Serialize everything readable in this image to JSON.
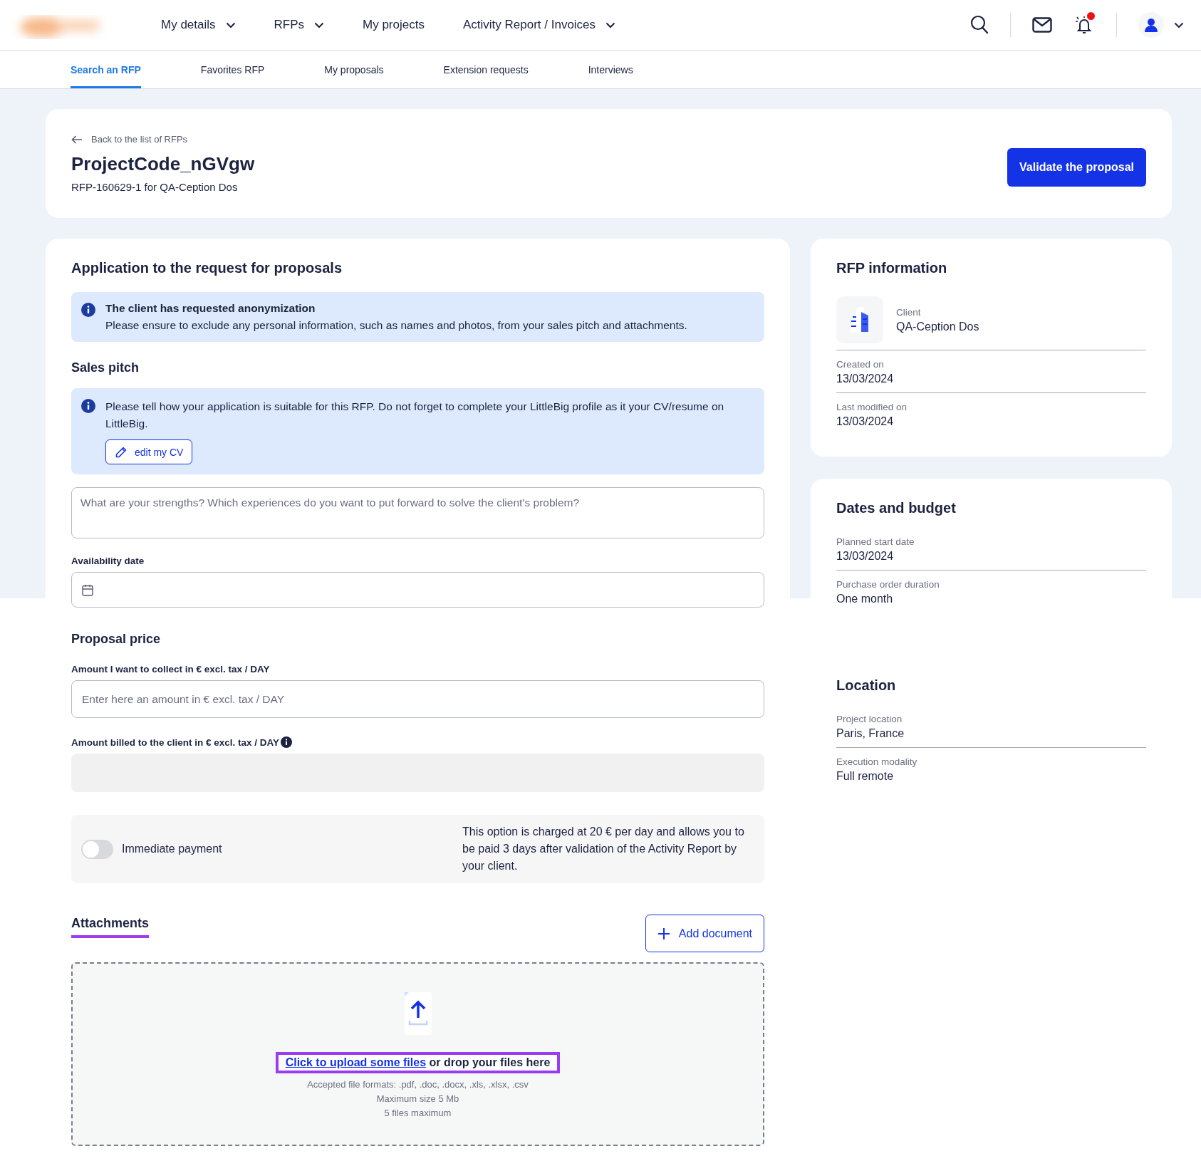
{
  "header": {
    "nav": [
      {
        "label": "My details",
        "dropdown": true
      },
      {
        "label": "RFPs",
        "dropdown": true
      },
      {
        "label": "My projects",
        "dropdown": false
      },
      {
        "label": "Activity Report / Invoices",
        "dropdown": true
      }
    ],
    "notifications": {
      "unread": true
    }
  },
  "tabs": [
    {
      "label": "Search an RFP",
      "selected": true
    },
    {
      "label": "Favorites RFP",
      "selected": false
    },
    {
      "label": "My proposals",
      "selected": false
    },
    {
      "label": "Extension requests",
      "selected": false
    },
    {
      "label": "Interviews",
      "selected": false
    }
  ],
  "project": {
    "back_link": "Back to the list of RFPs",
    "title": "ProjectCode_nGVgw",
    "subtitle": "RFP-160629-1 for QA-Ception Dos",
    "validate_button": "Validate the proposal"
  },
  "application": {
    "title": "Application to the request for proposals",
    "anonymization_notice": {
      "title": "The client has requested anonymization",
      "text": "Please ensure to exclude any personal information, such as names and photos, from your sales pitch and attachments."
    },
    "sales_pitch": {
      "title": "Sales pitch",
      "notice": "Please tell how your application is suitable for this RFP. Do not forget to complete your LittleBig profile as it your CV/resume on LittleBig.",
      "edit_cv_button": "edit my CV",
      "placeholder": "What are your strengths? Which experiences do you want to put forward to solve the client’s problem?"
    },
    "availability": {
      "label": "Availability date"
    },
    "proposal_price": {
      "title": "Proposal price",
      "amount_label": "Amount I want to collect in € excl. tax / DAY",
      "amount_placeholder": "Enter here an amount in € excl. tax / DAY",
      "billed_label": "Amount billed to the client in € excl. tax / DAY"
    },
    "immediate_payment": {
      "label": "Immediate payment",
      "on": false,
      "description": "This option is charged at 20 € per day and allows you to be paid 3 days after validation of the Activity Report by your client."
    },
    "attachments": {
      "title": "Attachments",
      "add_button": "Add document",
      "upload_link": "Click to upload some files",
      "upload_text": "or drop your files here",
      "formats": "Accepted file formats: .pdf, .doc, .docx, .xls, .xlsx, .csv",
      "max_size": "Maximum size 5 Mb",
      "max_files": "5 files maximum"
    }
  },
  "sidebar": [
    {
      "title": "RFP information",
      "client": {
        "label": "Client",
        "value": "QA-Ception Dos"
      },
      "fields": [
        {
          "label": "Created on",
          "value": "13/03/2024"
        },
        {
          "label": "Last modified on",
          "value": "13/03/2024"
        }
      ]
    },
    {
      "title": "Dates and budget",
      "fields": [
        {
          "label": "Planned start date",
          "value": "13/03/2024"
        },
        {
          "label": "Purchase order duration",
          "value": "One month"
        }
      ]
    },
    {
      "title": "Location",
      "fields": [
        {
          "label": "Project location",
          "value": "Paris, France"
        },
        {
          "label": "Execution modality",
          "value": "Full remote"
        }
      ]
    }
  ]
}
